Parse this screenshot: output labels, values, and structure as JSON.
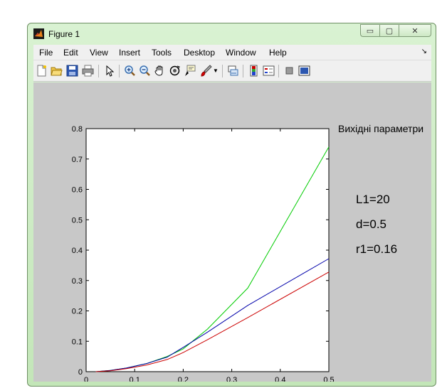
{
  "window": {
    "title": "Figure 1"
  },
  "menu": [
    "File",
    "Edit",
    "View",
    "Insert",
    "Tools",
    "Desktop",
    "Window",
    "Help"
  ],
  "toolbar_icons": [
    "new-figure-icon",
    "open-file-icon",
    "save-icon",
    "print-icon",
    "pointer-icon",
    "zoom-in-icon",
    "zoom-out-icon",
    "pan-icon",
    "rotate-3d-icon",
    "data-cursor-icon",
    "brush-icon",
    "link-plot-icon",
    "colorbar-icon",
    "legend-icon",
    "hide-plot-tools-icon",
    "show-plot-tools-icon"
  ],
  "annotations": {
    "title": "Вихідні параметри",
    "params": [
      "L1=20",
      "d=0.5",
      "r1=0.16"
    ]
  },
  "colors": {
    "green": "#00cc00",
    "blue": "#0000aa",
    "red": "#cc0000"
  },
  "chart_data": {
    "type": "line",
    "xlim": [
      0,
      0.5
    ],
    "ylim": [
      0,
      0.8
    ],
    "xticks": [
      0,
      0.1,
      0.2,
      0.3,
      0.4,
      0.5
    ],
    "yticks": [
      0,
      0.1,
      0.2,
      0.3,
      0.4,
      0.5,
      0.6,
      0.7,
      0.8
    ],
    "xticklabels": [
      "0",
      "0.1",
      "0.2",
      "0.3",
      "0.4",
      "0.5"
    ],
    "yticklabels": [
      "0",
      "0.1",
      "0.2",
      "0.3",
      "0.4",
      "0.5",
      "0.6",
      "0.7",
      "0.8"
    ],
    "grid": false,
    "series": [
      {
        "color": "#00cc00",
        "x": [
          0.02,
          0.05,
          0.083,
          0.125,
          0.167,
          0.2,
          0.25,
          0.333,
          0.5
        ],
        "y": [
          0,
          0.004,
          0.012,
          0.027,
          0.05,
          0.075,
          0.14,
          0.275,
          0.74
        ]
      },
      {
        "color": "#0000aa",
        "x": [
          0.02,
          0.05,
          0.083,
          0.125,
          0.167,
          0.2,
          0.25,
          0.333,
          0.5
        ],
        "y": [
          0,
          0.004,
          0.012,
          0.027,
          0.048,
          0.08,
          0.13,
          0.218,
          0.372
        ]
      },
      {
        "color": "#cc0000",
        "x": [
          0.02,
          0.05,
          0.083,
          0.125,
          0.167,
          0.2,
          0.25,
          0.333,
          0.5
        ],
        "y": [
          0,
          0.003,
          0.01,
          0.022,
          0.04,
          0.063,
          0.105,
          0.178,
          0.328
        ]
      }
    ]
  }
}
